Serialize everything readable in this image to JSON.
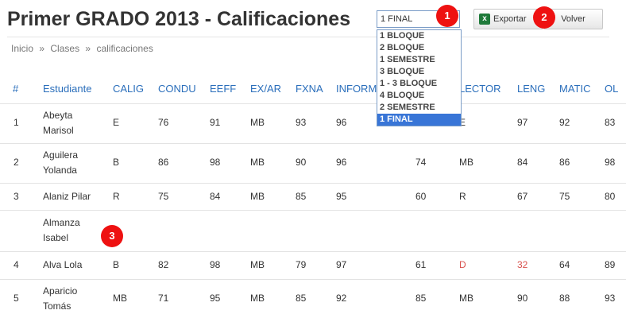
{
  "page": {
    "title": "Primer GRADO 2013 - Calificaciones",
    "breadcrumb": [
      "Inicio",
      "»",
      "Clases",
      "»",
      "calificaciones"
    ]
  },
  "toolbar": {
    "period_selected": "1 FINAL",
    "period_options": [
      "1 BLOQUE",
      "2 BLOQUE",
      "1 SEMESTRE",
      "3 BLOQUE",
      "1 - 3 BLOQUE",
      "4 BLOQUE",
      "2 SEMESTRE",
      "1 FINAL"
    ],
    "export_label": "Exportar",
    "back_label": "Volver"
  },
  "badges": [
    "1",
    "2",
    "3"
  ],
  "table": {
    "headers": [
      "#",
      "Estudiante",
      "CALIG",
      "CONDU",
      "EEFF",
      "EX/AR",
      "FXNA",
      "INFORM",
      "LECTOR",
      "LENG",
      "MATIC",
      "OL"
    ],
    "rows": [
      {
        "num": "1",
        "name": "Abeyta Marisol",
        "calig": "E",
        "condu": "76",
        "eeff": "91",
        "exar": "MB",
        "fxna": "93",
        "inform": "96",
        "x": "",
        "lector": "E",
        "leng": "97",
        "matic": "92",
        "ol": "83"
      },
      {
        "num": "2",
        "name": "Aguilera Yolanda",
        "calig": "B",
        "condu": "86",
        "eeff": "98",
        "exar": "MB",
        "fxna": "90",
        "inform": "96",
        "x": "74",
        "lector": "MB",
        "leng": "84",
        "matic": "86",
        "ol": "98"
      },
      {
        "num": "3",
        "name": "Alaniz Pilar",
        "calig": "R",
        "condu": "75",
        "eeff": "84",
        "exar": "MB",
        "fxna": "85",
        "inform": "95",
        "x": "60",
        "lector": "R",
        "leng": "67",
        "matic": "75",
        "ol": "80"
      },
      {
        "num": "",
        "name": "Almanza Isabel",
        "calig": "",
        "condu": "",
        "eeff": "",
        "exar": "",
        "fxna": "",
        "inform": "",
        "x": "",
        "lector": "",
        "leng": "",
        "matic": "",
        "ol": ""
      },
      {
        "num": "4",
        "name": "Alva Lola",
        "calig": "B",
        "condu": "82",
        "eeff": "98",
        "exar": "MB",
        "fxna": "79",
        "inform": "97",
        "x": "61",
        "lector": "D",
        "leng": "32",
        "matic": "64",
        "ol": "89"
      },
      {
        "num": "5",
        "name": "Aparicio Tomás",
        "calig": "MB",
        "condu": "71",
        "eeff": "95",
        "exar": "MB",
        "fxna": "85",
        "inform": "92",
        "x": "85",
        "lector": "MB",
        "leng": "90",
        "matic": "88",
        "ol": "93"
      }
    ]
  },
  "colors": {
    "accent": "#2a6ebb",
    "failing": "#d9534f",
    "badge": "#e11111",
    "selected_option": "#3875d7"
  }
}
